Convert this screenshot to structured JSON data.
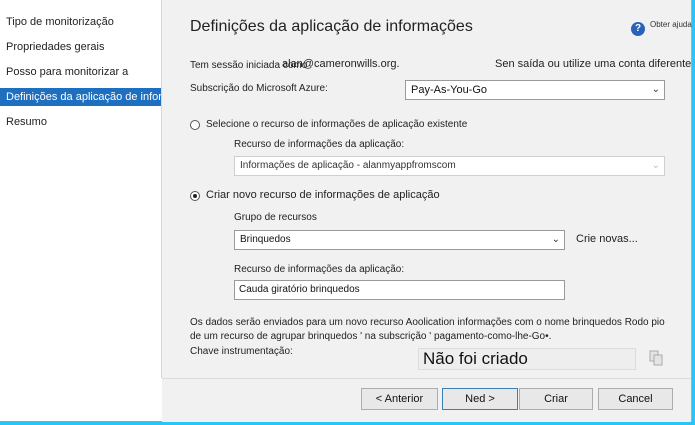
{
  "sidebar": {
    "items": [
      {
        "label": "Tipo de monitorização"
      },
      {
        "label": "Propriedades gerais"
      },
      {
        "label": "Posso para monitorizar a"
      },
      {
        "label": "Definições da aplicação de informações"
      },
      {
        "label": "Resumo"
      }
    ]
  },
  "header": {
    "title": "Definições da aplicação de informações",
    "help_label": "Obter ajuda"
  },
  "session": {
    "label": "Tem sessão iniciada como",
    "email": "alan@cameronwills.org.",
    "signout_link": "Sen saída ou utilize uma conta diferente"
  },
  "subscription": {
    "label": "Subscrição do Microsoft Azure:",
    "value": "Pay-As-You-Go"
  },
  "existing": {
    "radio_label": "Selecione o recurso de informações de aplicação existente",
    "resource_label": "Recurso de informações da aplicação:",
    "resource_value": "Informações de aplicação - alanmyappfromscom"
  },
  "create_new": {
    "radio_label": "Criar novo recurso de informações de aplicação",
    "group_label": "Grupo de recursos",
    "group_value": "Brinquedos",
    "create_link": "Crie novas...",
    "resource_label": "Recurso de informações da aplicação:",
    "resource_value": "Cauda giratório brinquedos"
  },
  "info_text": {
    "line1": "Os dados serão enviados para um novo recurso Aoolication informações com o nome brinquedos Rodo pio",
    "line2": "de um recurso de agrupar brinquedos ' na subscrição ' pagamento-como-lhe-Go•."
  },
  "ikey": {
    "label": "Chave instrumentação:",
    "value": "Não foi criado"
  },
  "footer": {
    "back": "< Anterior",
    "next": "Ned >",
    "create": "Criar",
    "cancel": "Cancel"
  },
  "colors": {
    "accent": "#1e6fbf",
    "frame": "#29c5f6"
  }
}
